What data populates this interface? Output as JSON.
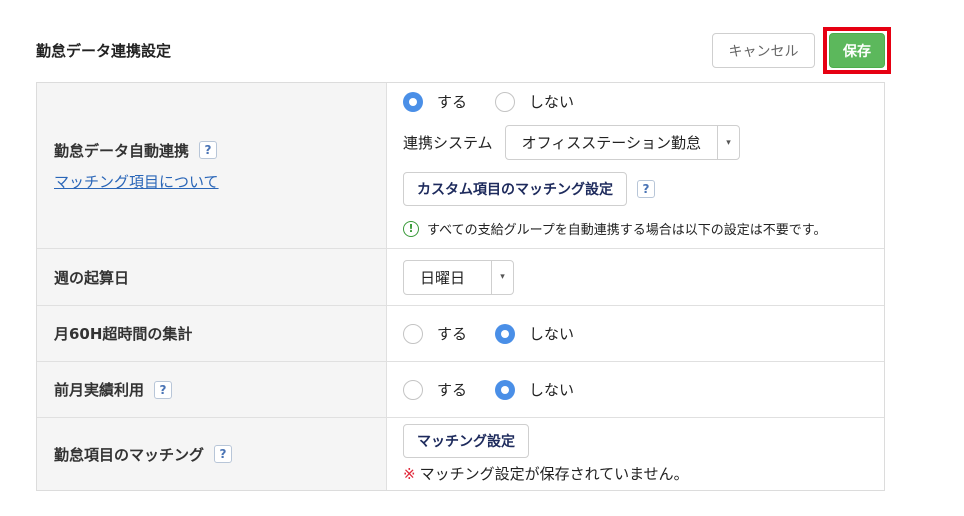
{
  "header": {
    "title": "勤怠データ連携設定",
    "cancel_label": "キャンセル",
    "save_label": "保存"
  },
  "rows": {
    "auto_link": {
      "label": "勤怠データ自動連携",
      "link": "マッチング項目について",
      "option_yes": "する",
      "option_no": "しない",
      "selected": "する",
      "system_label": "連携システム",
      "system_value": "オフィスステーション勤怠",
      "custom_button": "カスタム項目のマッチング設定",
      "info_text": "すべての支給グループを自動連携する場合は以下の設定は不要です。"
    },
    "week_start": {
      "label": "週の起算日",
      "value": "日曜日"
    },
    "overtime_60h": {
      "label": "月60H超時間の集計",
      "option_yes": "する",
      "option_no": "しない",
      "selected": "しない"
    },
    "prev_month": {
      "label": "前月実績利用",
      "option_yes": "する",
      "option_no": "しない",
      "selected": "しない"
    },
    "matching": {
      "label": "勤怠項目のマッチング",
      "button": "マッチング設定",
      "warn_mark": "※",
      "warn_text": "マッチング設定が保存されていません。"
    }
  },
  "icons": {
    "help": "?",
    "info": "!",
    "caret": "▾"
  },
  "colors": {
    "save": "#5cb85c",
    "highlight": "#e60012",
    "radio_on": "#4a8fe7",
    "link": "#2a66b8",
    "warn": "#e0283a",
    "info": "#3a9a3a"
  }
}
